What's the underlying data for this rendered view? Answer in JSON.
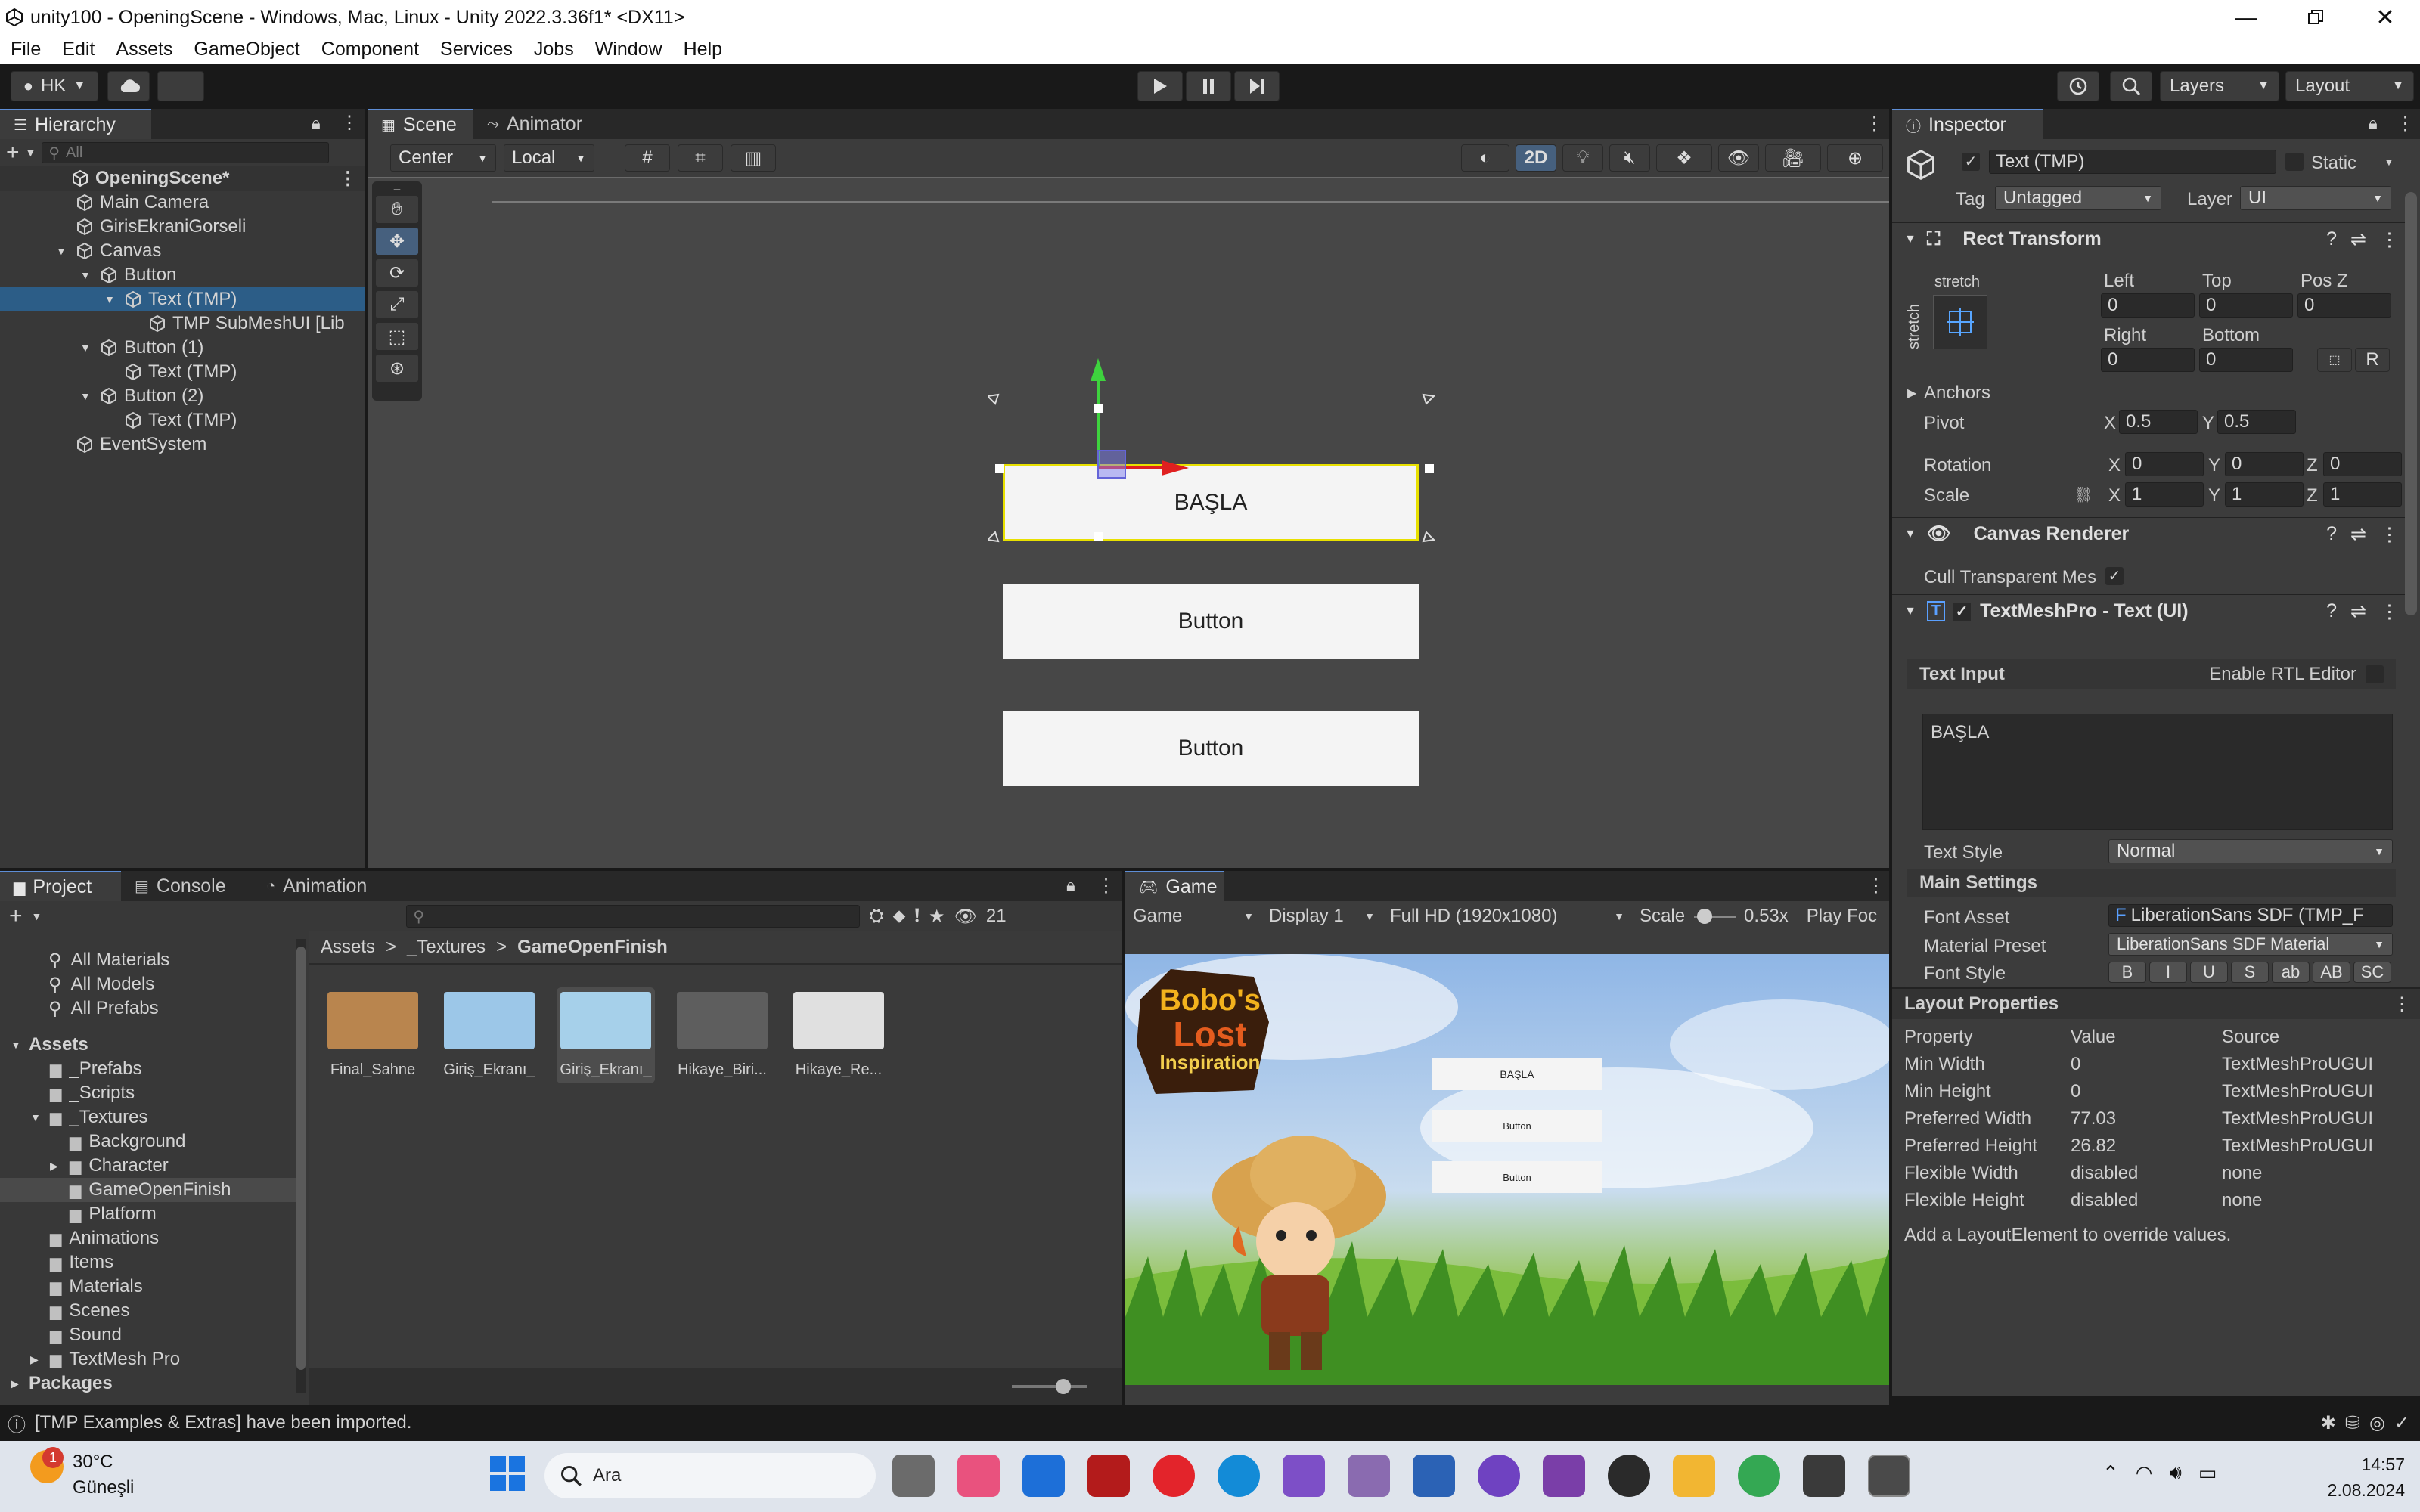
{
  "window": {
    "title": "unity100 - OpeningScene - Windows, Mac, Linux - Unity 2022.3.36f1* <DX11>"
  },
  "menu": [
    "File",
    "Edit",
    "Assets",
    "GameObject",
    "Component",
    "Services",
    "Jobs",
    "Window",
    "Help"
  ],
  "toolbar": {
    "account": "HK",
    "layers": "Layers",
    "layout": "Layout"
  },
  "hierarchy": {
    "tab": "Hierarchy",
    "search_placeholder": "All",
    "scene": "OpeningScene*",
    "items": [
      {
        "label": "Main Camera"
      },
      {
        "label": "GirisEkraniGorseli"
      },
      {
        "label": "Canvas"
      },
      {
        "label": "Button"
      },
      {
        "label": "Text (TMP)"
      },
      {
        "label": "TMP SubMeshUI [Lib"
      },
      {
        "label": "Button (1)"
      },
      {
        "label": "Text (TMP)"
      },
      {
        "label": "Button (2)"
      },
      {
        "label": "Text (TMP)"
      },
      {
        "label": "EventSystem"
      }
    ]
  },
  "scene": {
    "tabs": [
      "Scene",
      "Animator"
    ],
    "pivot": "Center",
    "space": "Local",
    "mode2d": "2D",
    "buttons": [
      "BAŞLA",
      "Button",
      "Button"
    ]
  },
  "inspector": {
    "tab": "Inspector",
    "object_name": "Text (TMP)",
    "static_label": "Static",
    "tag_label": "Tag",
    "tag": "Untagged",
    "layer_label": "Layer",
    "layer": "UI",
    "rect": {
      "title": "Rect Transform",
      "stretch_top": "stretch",
      "stretch_side": "stretch",
      "left_label": "Left",
      "left": "0",
      "top_label": "Top",
      "top": "0",
      "posz_label": "Pos Z",
      "posz": "0",
      "right_label": "Right",
      "right": "0",
      "bottom_label": "Bottom",
      "bottom": "0",
      "r_btn": "R",
      "anchors": "Anchors",
      "pivot_label": "Pivot",
      "pivot_x": "0.5",
      "pivot_y": "0.5",
      "rotation_label": "Rotation",
      "rot_x": "0",
      "rot_y": "0",
      "rot_z": "0",
      "scale_label": "Scale",
      "scale_x": "1",
      "scale_y": "1",
      "scale_z": "1",
      "x": "X",
      "y": "Y",
      "z": "Z"
    },
    "canvas_renderer": {
      "title": "Canvas Renderer",
      "cull": "Cull Transparent Mes"
    },
    "tmp": {
      "title": "TextMeshPro - Text (UI)",
      "text_input": "Text Input",
      "rtl": "Enable RTL Editor",
      "text": "BAŞLA",
      "text_style_label": "Text Style",
      "text_style": "Normal",
      "main_settings": "Main Settings",
      "font_asset_label": "Font Asset",
      "font_asset": "LiberationSans SDF (TMP_F",
      "material_label": "Material Preset",
      "material": "LiberationSans SDF Material",
      "font_style_label": "Font Style",
      "styles": [
        "B",
        "I",
        "U",
        "S",
        "ab",
        "AB",
        "SC"
      ]
    },
    "layout": {
      "title": "Layout Properties",
      "headers": [
        "Property",
        "Value",
        "Source"
      ],
      "rows": [
        [
          "Min Width",
          "0",
          "TextMeshProUGUI"
        ],
        [
          "Min Height",
          "0",
          "TextMeshProUGUI"
        ],
        [
          "Preferred Width",
          "77.03",
          "TextMeshProUGUI"
        ],
        [
          "Preferred Height",
          "26.82",
          "TextMeshProUGUI"
        ],
        [
          "Flexible Width",
          "disabled",
          "none"
        ],
        [
          "Flexible Height",
          "disabled",
          "none"
        ]
      ],
      "note": "Add a LayoutElement to override values."
    }
  },
  "project": {
    "tabs": [
      "Project",
      "Console",
      "Animation"
    ],
    "hidden_count": "21",
    "favorites": [
      "All Materials",
      "All Models",
      "All Prefabs"
    ],
    "tree": [
      {
        "label": "Assets",
        "level": 0,
        "bold": true
      },
      {
        "label": "_Prefabs",
        "level": 1
      },
      {
        "label": "_Scripts",
        "level": 1
      },
      {
        "label": "_Textures",
        "level": 1
      },
      {
        "label": "Background",
        "level": 2
      },
      {
        "label": "Character",
        "level": 2
      },
      {
        "label": "GameOpenFinish",
        "level": 2,
        "selected": true
      },
      {
        "label": "Platform",
        "level": 2
      },
      {
        "label": "Animations",
        "level": 1
      },
      {
        "label": "Items",
        "level": 1
      },
      {
        "label": "Materials",
        "level": 1
      },
      {
        "label": "Scenes",
        "level": 1
      },
      {
        "label": "Sound",
        "level": 1
      },
      {
        "label": "TextMesh Pro",
        "level": 1
      },
      {
        "label": "Packages",
        "level": 0,
        "bold": true
      }
    ],
    "breadcrumb": [
      "Assets",
      "_Textures",
      "GameOpenFinish"
    ],
    "assets": [
      "Final_Sahne",
      "Giriş_Ekranı_",
      "Giriş_Ekranı_",
      "Hikaye_Biri...",
      "Hikaye_Re..."
    ]
  },
  "game": {
    "tab": "Game",
    "mode": "Game",
    "display": "Display 1",
    "resolution": "Full HD (1920x1080)",
    "scale_label": "Scale",
    "scale": "0.53x",
    "play_focus": "Play Foc",
    "logo": [
      "Bobo's",
      "Lost",
      "Inspiration"
    ],
    "buttons": [
      "BAŞLA",
      "Button",
      "Button"
    ]
  },
  "status": {
    "message": "[TMP Examples & Extras] have been imported."
  },
  "taskbar": {
    "weather_badge": "1",
    "temp": "30°C",
    "weather": "Güneşli",
    "search": "Ara",
    "time": "14:57",
    "date": "2.08.2024"
  }
}
